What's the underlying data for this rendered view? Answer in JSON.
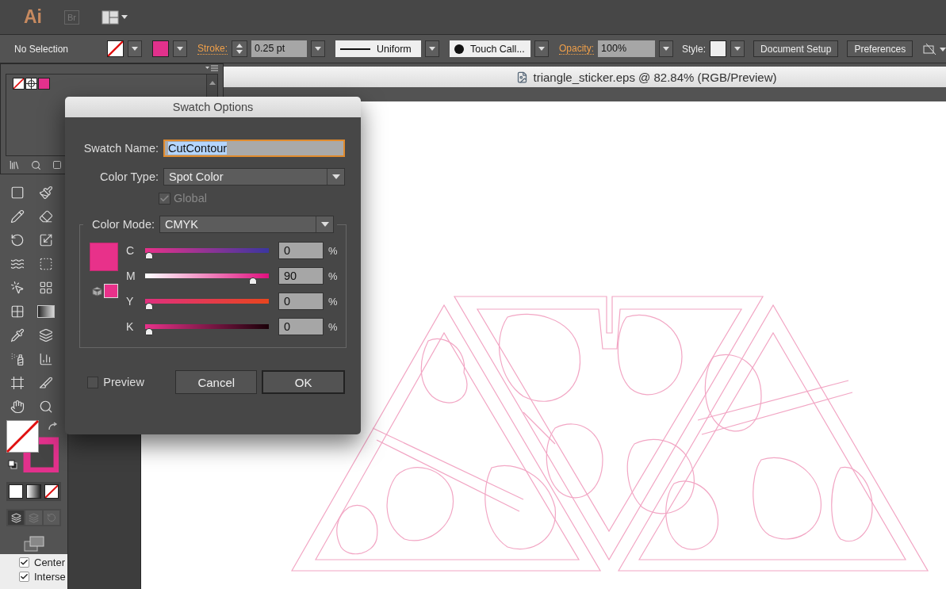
{
  "app_bar": {
    "logo": "Ai",
    "bridge": "Br"
  },
  "control_bar": {
    "selection": "No Selection",
    "stroke_label": "Stroke:",
    "stroke_weight": "0.25 pt",
    "stroke_profile": "Uniform",
    "brush": "Touch Call...",
    "opacity_label": "Opacity:",
    "opacity": "100%",
    "style_label": "Style:",
    "buttons": [
      "Document Setup",
      "Preferences"
    ]
  },
  "document_tab": {
    "title": "triangle_sticker.eps @ 82.84% (RGB/Preview)"
  },
  "dialog": {
    "title": "Swatch Options",
    "swatch_name_label": "Swatch Name:",
    "swatch_name": "CutContour",
    "swatch_name_selected": true,
    "color_type_label": "Color Type:",
    "color_type": "Spot Color",
    "global": {
      "label": "Global",
      "checked": true,
      "disabled": true
    },
    "color_mode_label": "Color Mode:",
    "color_mode": "CMYK",
    "channels": [
      {
        "name": "C",
        "value": "0",
        "unit": "%",
        "level": 0
      },
      {
        "name": "M",
        "value": "90",
        "unit": "%",
        "level": 0.9
      },
      {
        "name": "Y",
        "value": "0",
        "unit": "%",
        "level": 0
      },
      {
        "name": "K",
        "value": "0",
        "unit": "%",
        "level": 0
      }
    ],
    "preview": {
      "label": "Preview",
      "checked": false
    },
    "buttons": [
      {
        "label": "Cancel",
        "default": false
      },
      {
        "label": "OK",
        "default": true
      }
    ]
  },
  "options_panel": {
    "checkboxes": [
      {
        "label": "Center",
        "checked": true
      },
      {
        "label": "Interse",
        "checked": true
      }
    ]
  }
}
